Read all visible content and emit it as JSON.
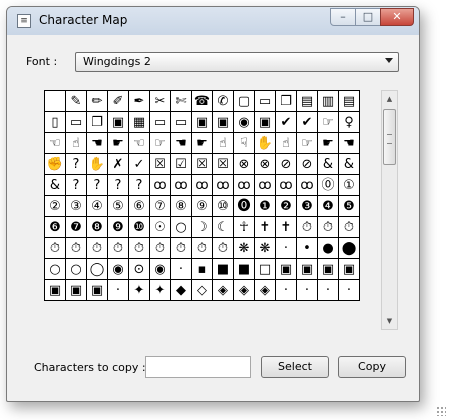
{
  "window": {
    "title": "Character Map",
    "icons": {
      "app": "character-map-icon",
      "minimize": "minimize-icon",
      "maximize": "maximize-icon",
      "close": "close-icon"
    }
  },
  "font": {
    "label": "Font :",
    "selected": "Wingdings 2",
    "dropdown_icon": "chevron-down-icon"
  },
  "grid": {
    "rows": [
      [
        "",
        "✎",
        "✏",
        "✐",
        "✒",
        "✂",
        "✄",
        "☎",
        "✆",
        "▢",
        "▭",
        "❐",
        "▤",
        "▥",
        "▤"
      ],
      [
        "▯",
        "▭",
        "❐",
        "▣",
        "▦",
        "▭",
        "▭",
        "▣",
        "▣",
        "◉",
        "▣",
        "✔",
        "✔",
        "☞",
        "♀"
      ],
      [
        "☜",
        "☝",
        "☚",
        "☛",
        "☜",
        "☞",
        "☚",
        "☛",
        "☝",
        "☟",
        "✋",
        "☝",
        "☞",
        "☛",
        "☚"
      ],
      [
        "✊",
        "?",
        "✋",
        "✗",
        "✓",
        "☒",
        "☑",
        "☒",
        "☒",
        "⊗",
        "⊗",
        "⊘",
        "⊘",
        "&",
        "&"
      ],
      [
        "&",
        "?",
        "?",
        "?",
        "?",
        "ꝏ",
        "ꝏ",
        "ꝏ",
        "ꝏ",
        "ꝏ",
        "ꝏ",
        "ꝏ",
        "ꝏ",
        "⓪",
        "①"
      ],
      [
        "②",
        "③",
        "④",
        "⑤",
        "⑥",
        "⑦",
        "⑧",
        "⑨",
        "⑩",
        "⓿",
        "❶",
        "❷",
        "❸",
        "❹",
        "❺"
      ],
      [
        "❻",
        "❼",
        "❽",
        "❾",
        "❿",
        "☉",
        "○",
        "☽",
        "☾",
        "☥",
        "✝",
        "✝",
        "⏱",
        "⏱",
        "⏱"
      ],
      [
        "⏱",
        "⏱",
        "⏱",
        "⏱",
        "⏱",
        "⏱",
        "⏱",
        "⏱",
        "⏱",
        "❋",
        "❋",
        "·",
        "•",
        "●",
        "⬤"
      ],
      [
        "○",
        "○",
        "◯",
        "◉",
        "⊙",
        "◉",
        "·",
        "▪",
        "■",
        "■",
        "□",
        "▣",
        "▣",
        "▣",
        "▣"
      ],
      [
        "▣",
        "▣",
        "▣",
        "·",
        "✦",
        "✦",
        "◆",
        "◇",
        "◈",
        "◈",
        "◈",
        "·",
        "·",
        "·",
        "·"
      ]
    ]
  },
  "scrollbar": {
    "up_icon": "scroll-up-icon",
    "down_icon": "scroll-down-icon"
  },
  "copy": {
    "label": "Characters to copy :",
    "value": "",
    "select_label": "Select",
    "copy_label": "Copy"
  },
  "colors": {
    "close_button": "#c7463a",
    "titlebar": "#dbe4ef",
    "dialog_background": "#f0f0f0"
  }
}
